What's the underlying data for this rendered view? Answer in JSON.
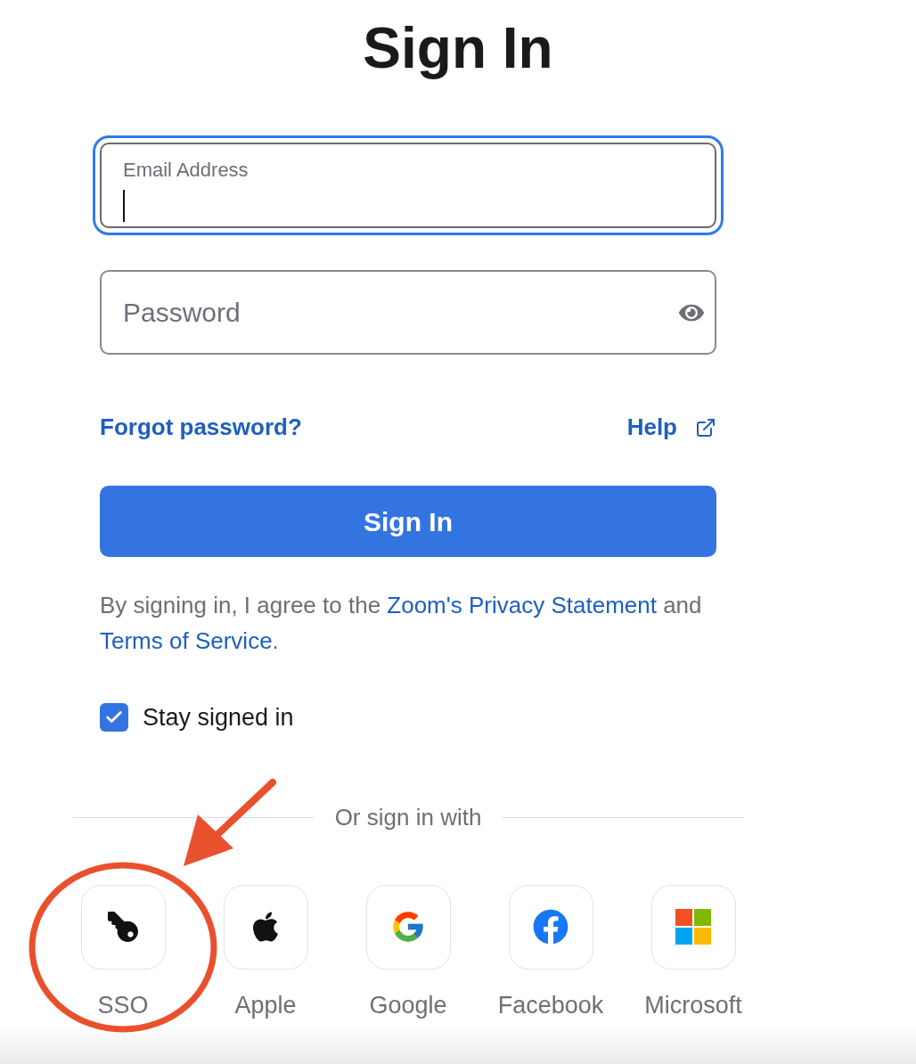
{
  "title": "Sign In",
  "email_field": {
    "label": "Email Address",
    "focused": true
  },
  "password_field": {
    "placeholder": "Password",
    "focused": false
  },
  "forgot_link": "Forgot password?",
  "help_link": "Help",
  "sign_in_button": "Sign In",
  "consent": [
    {
      "kind": "text",
      "text": "By signing in, I agree to the "
    },
    {
      "kind": "link",
      "text": "Zoom's Privacy Statement"
    },
    {
      "kind": "text",
      "text": " and "
    },
    {
      "kind": "link",
      "text": "Terms of Service"
    },
    {
      "kind": "text",
      "text": "."
    }
  ],
  "stay_signed_in": {
    "label": "Stay signed in",
    "checked": true
  },
  "divider_text": "Or sign in with",
  "social": [
    {
      "kind": "key",
      "label": "SSO",
      "highlighted": true
    },
    {
      "kind": "apple",
      "label": "Apple",
      "highlighted": false
    },
    {
      "kind": "google",
      "label": "Google",
      "highlighted": false
    },
    {
      "kind": "facebook",
      "label": "Facebook",
      "highlighted": false
    },
    {
      "kind": "microsoft",
      "label": "Microsoft",
      "highlighted": false
    }
  ]
}
